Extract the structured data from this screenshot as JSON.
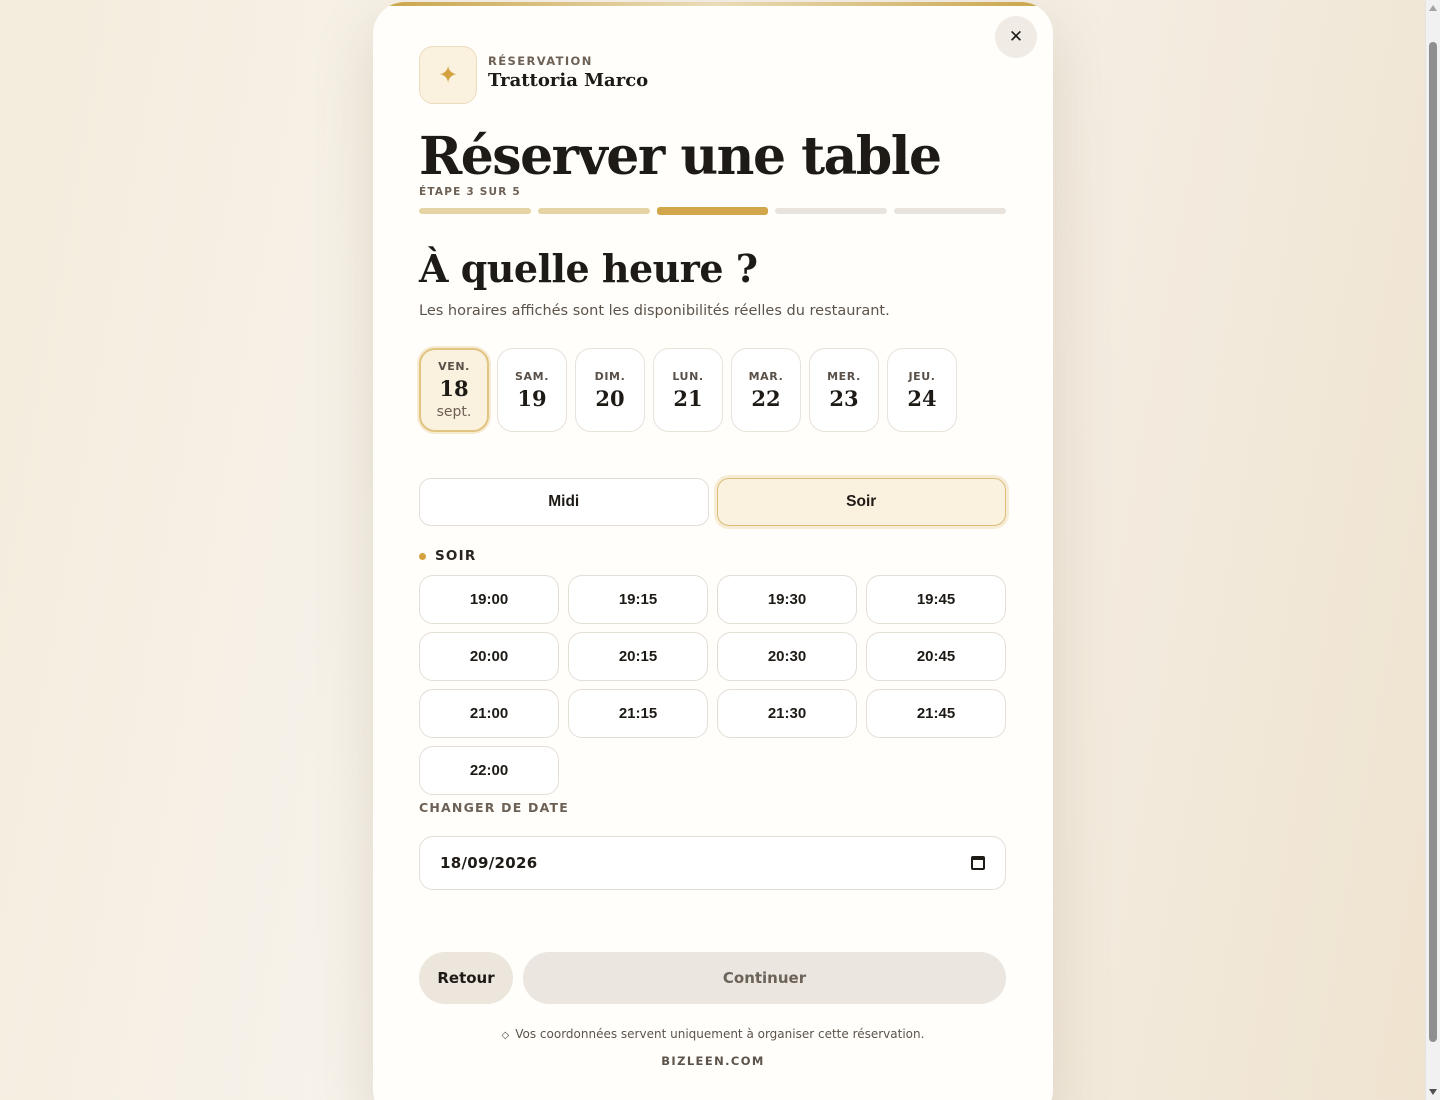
{
  "header": {
    "kicker": "RÉSERVATION",
    "restaurant": "Trattoria Marco",
    "brand_icon": "sparkle-icon",
    "close_label": "✕"
  },
  "title": "Réserver une table",
  "progress": {
    "label": "ÉTAPE 3 SUR 5",
    "current": 3,
    "total": 5
  },
  "step": {
    "question": "À quelle heure ?",
    "subtitle": "Les horaires affichés sont les disponibilités réelles du restaurant."
  },
  "days": [
    {
      "dow": "VEN.",
      "num": "18",
      "mon": "sept.",
      "selected": true
    },
    {
      "dow": "SAM.",
      "num": "19"
    },
    {
      "dow": "DIM.",
      "num": "20"
    },
    {
      "dow": "LUN.",
      "num": "21"
    },
    {
      "dow": "MAR.",
      "num": "22"
    },
    {
      "dow": "MER.",
      "num": "23"
    },
    {
      "dow": "JEU.",
      "num": "24"
    }
  ],
  "period": {
    "midi": "Midi",
    "soir": "Soir",
    "selected": "soir"
  },
  "slots": {
    "section_label": "SOIR",
    "times": [
      "19:00",
      "19:15",
      "19:30",
      "19:45",
      "20:00",
      "20:15",
      "20:30",
      "20:45",
      "21:00",
      "21:15",
      "21:30",
      "21:45",
      "22:00"
    ]
  },
  "date_change": {
    "label": "CHANGER DE DATE",
    "value": "18/09/2026"
  },
  "actions": {
    "back": "Retour",
    "continue": "Continuer"
  },
  "footer": {
    "privacy": "Vos coordonnées servent uniquement à organiser cette réservation.",
    "privacy_icon": "◇",
    "powered": "BIZLEEN.COM"
  },
  "colors": {
    "accent": "#d2a64a",
    "selected_bg": "#faf1df",
    "text": "#1e1a16"
  }
}
